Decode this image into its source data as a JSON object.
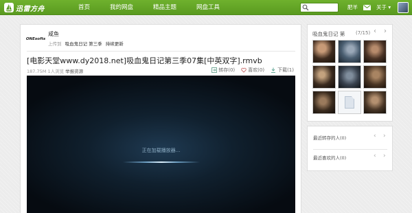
{
  "brand": {
    "name": "迅雷方舟",
    "accent": "#62a528"
  },
  "nav": {
    "items": [
      "首页",
      "我的网盘",
      "精品主题",
      "网盘工具"
    ]
  },
  "header": {
    "search_placeholder": "",
    "user_name": "肥羊",
    "about_label": "关于",
    "about_caret": "▾"
  },
  "uploader": {
    "logo_text": "ONEsofts",
    "name": "咸鱼",
    "upload_prefix": "上传到",
    "folder1": "吸血鬼日记 第三季",
    "folder2": "持续更新"
  },
  "file": {
    "title": "[电影天堂www.dy2018.net]吸血鬼日记第三季07集[中英双字].rmvb",
    "size": "187.75M",
    "visitors": "1人浏览",
    "report_label": "举报资源",
    "actions": {
      "forward": "转存(0)",
      "like": "喜欢(0)",
      "download": "下载(1)"
    }
  },
  "player": {
    "loading_text": "正在加载播放器..."
  },
  "episodes": {
    "title": "吸血鬼日记 第",
    "count": "(7/15)",
    "prev": "‹",
    "next": "›"
  },
  "related": {
    "forwarded_label": "最近转存的人(0)",
    "liked_label": "最近喜欢的人(0)",
    "prev": "‹",
    "next": "›"
  }
}
